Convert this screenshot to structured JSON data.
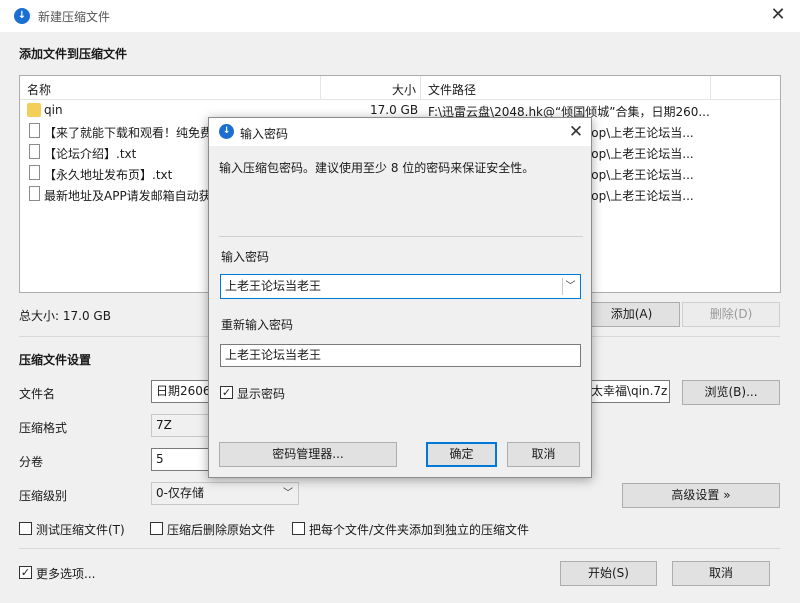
{
  "window": {
    "title": "新建压缩文件",
    "app_icon": "bandizip-icon",
    "close_symbol": "✕"
  },
  "files_section": {
    "heading": "添加文件到压缩文件",
    "columns": {
      "name": "名称",
      "size": "大小",
      "path": "文件路径"
    },
    "rows": [
      {
        "name": "qin",
        "size": "17.0 GB",
        "path": "F:\\迅雷云盘\\2048.hk@“倾国倾城”合集，日期260...",
        "icon": "folder-icon"
      },
      {
        "name": "【来了就能下载和观看！纯免费",
        "size": "",
        "path": "ctop\\上老王论坛当...",
        "icon": "file-icon"
      },
      {
        "name": "【论坛介绍】.txt",
        "size": "",
        "path": "ctop\\上老王论坛当...",
        "icon": "file-icon"
      },
      {
        "name": "【永久地址发布页】.txt",
        "size": "",
        "path": "ctop\\上老王论坛当...",
        "icon": "file-icon"
      },
      {
        "name": "最新地址及APP请发邮箱自动获",
        "size": "",
        "path": "ctop\\上老王论坛当...",
        "icon": "file-icon"
      }
    ],
    "total_size": "总大小: 17.0 GB",
    "add_button": "添加(A)",
    "delete_button": "删除(D)"
  },
  "settings": {
    "heading": "压缩文件设置",
    "filename_label": "文件名",
    "filename_value": "日期2606",
    "filename_value_tail": "太幸福\\qin.7z",
    "browse_button": "浏览(B)...",
    "format_label": "压缩格式",
    "format_value": "7Z",
    "split_label": "分卷",
    "split_value": "5",
    "level_label": "压缩级别",
    "level_value": "0-仅存储",
    "advanced_button": "高级设置 »",
    "test_archive": {
      "label": "测试压缩文件(T)",
      "checked": false
    },
    "delete_after": {
      "label": "压缩后删除原始文件",
      "checked": false
    },
    "separate_archives": {
      "label": "把每个文件/文件夹添加到独立的压缩文件",
      "checked": false
    }
  },
  "footer": {
    "more_options": {
      "label": "更多选项...",
      "checked": true
    },
    "start_button": "开始(S)",
    "cancel_button": "取消"
  },
  "password_dialog": {
    "title": "输入密码",
    "description": "输入压缩包密码。建议使用至少 8 位的密码来保证安全性。",
    "password_label": "输入密码",
    "password_value": "上老王论坛当老王",
    "reenter_label": "重新输入密码",
    "reenter_value": "上老王论坛当老王",
    "show_password": {
      "label": "显示密码",
      "checked": true
    },
    "manager_button": "密码管理器...",
    "ok_button": "确定",
    "cancel_button": "取消"
  }
}
